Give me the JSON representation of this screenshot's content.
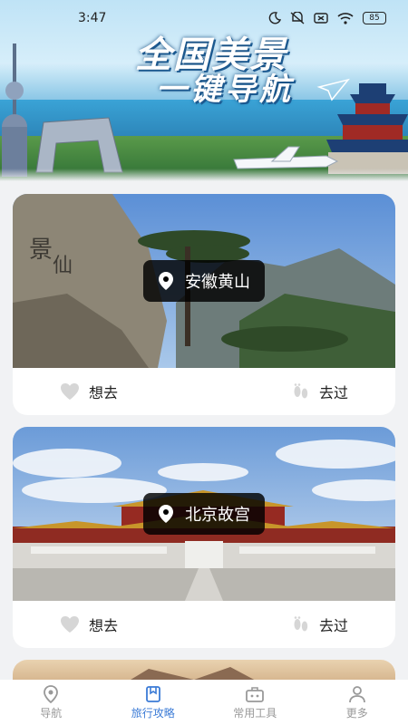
{
  "status_bar": {
    "time": "3:47",
    "battery": "85",
    "icons": [
      "moon-icon",
      "mute-icon",
      "sim-off-icon",
      "wifi-icon",
      "battery-icon"
    ]
  },
  "hero": {
    "title_line1": "全国美景",
    "title_line2": "一键导航"
  },
  "cards": [
    {
      "location": "安徽黄山",
      "want_label": "想去",
      "visited_label": "去过"
    },
    {
      "location": "北京故宫",
      "want_label": "想去",
      "visited_label": "去过"
    }
  ],
  "nav": {
    "items": [
      {
        "label": "导航",
        "icon": "location-pin-icon",
        "active": false
      },
      {
        "label": "旅行攻略",
        "icon": "bookmark-icon",
        "active": true
      },
      {
        "label": "常用工具",
        "icon": "toolbox-icon",
        "active": false
      },
      {
        "label": "更多",
        "icon": "user-icon",
        "active": false
      }
    ]
  },
  "colors": {
    "accent": "#3b7bd6",
    "inactive": "#999999",
    "badge_bg": "#000000"
  }
}
